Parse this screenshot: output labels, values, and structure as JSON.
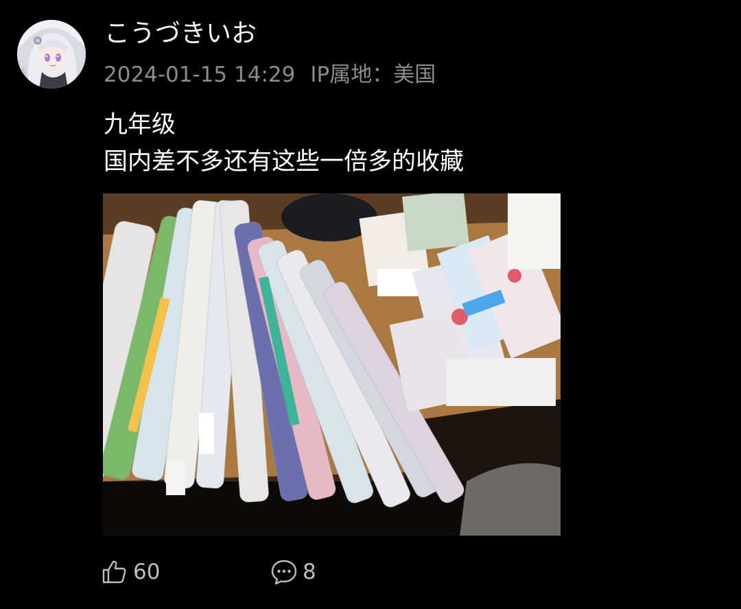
{
  "post": {
    "author": {
      "name": "こうづきいお",
      "avatar_icon": "anime-girl-avatar-icon"
    },
    "timestamp": "2024-01-15 14:29",
    "ip_location": "IP属地：美国",
    "text_lines": [
      "九年级",
      "国内差不多还有这些一倍多的收藏"
    ],
    "image_icon": "photo-of-rolled-posters-and-boxed-figures"
  },
  "actions": {
    "like": {
      "icon": "thumbs-up-icon",
      "count": "60"
    },
    "comment": {
      "icon": "comment-bubble-icon",
      "count": "8"
    }
  },
  "colors": {
    "background": "#000000",
    "meta_text": "#8c8c8c",
    "action_text": "#bdbdbd"
  }
}
